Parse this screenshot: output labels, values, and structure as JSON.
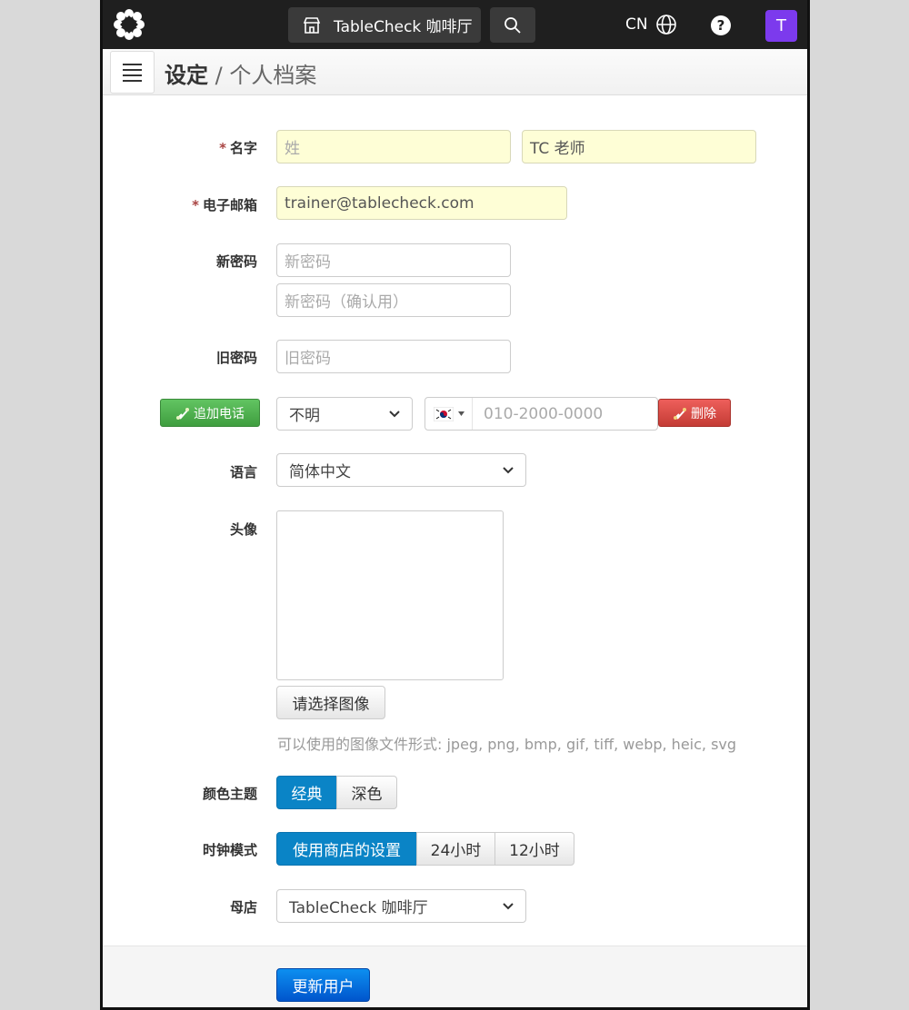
{
  "topbar": {
    "venue_label": "TableCheck 咖啡厅",
    "lang": "CN",
    "avatar_letter": "T"
  },
  "header": {
    "section": "设定",
    "separator": " / ",
    "page": "个人档案"
  },
  "form": {
    "name_label": "名字",
    "required_mark": "*",
    "last_name_placeholder": "姓",
    "first_name_value": "TC 老师",
    "email_label": "电子邮箱",
    "email_value": "trainer@tablecheck.com",
    "new_password_label": "新密码",
    "new_password_placeholder": "新密码",
    "confirm_password_placeholder": "新密码（确认用）",
    "old_password_label": "旧密码",
    "old_password_placeholder": "旧密码",
    "add_phone_label": "追加电话",
    "phone_type_value": "不明",
    "phone_placeholder": "010-2000-0000",
    "delete_label": "删除",
    "language_label": "语言",
    "language_value": "简体中文",
    "avatar_label": "头像",
    "choose_image_label": "请选择图像",
    "image_hint": "可以使用的图像文件形式: jpeg, png, bmp, gif, tiff, webp, heic, svg",
    "theme_label": "颜色主题",
    "theme_options": [
      "经典",
      "深色"
    ],
    "clock_label": "时钟模式",
    "clock_options": [
      "使用商店的设置",
      "24小时",
      "12小时"
    ],
    "home_store_label": "母店",
    "home_store_value": "TableCheck 咖啡厅",
    "submit_label": "更新用户"
  }
}
